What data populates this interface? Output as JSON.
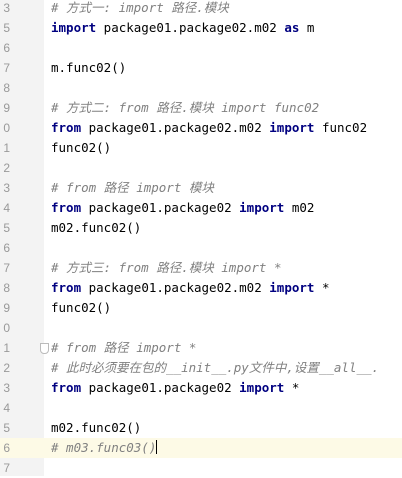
{
  "editor": {
    "lines": [
      {
        "n": "3",
        "parts": [
          {
            "t": "# 方式一: import 路径.模块",
            "c": "cm"
          }
        ]
      },
      {
        "n": "5",
        "parts": [
          {
            "t": "import",
            "c": "kw"
          },
          {
            "t": " package01.package02.m02 ",
            "c": ""
          },
          {
            "t": "as",
            "c": "kw"
          },
          {
            "t": " m",
            "c": ""
          }
        ]
      },
      {
        "n": "6",
        "parts": []
      },
      {
        "n": "7",
        "parts": [
          {
            "t": "m.func02()",
            "c": ""
          }
        ]
      },
      {
        "n": "8",
        "parts": []
      },
      {
        "n": "9",
        "parts": [
          {
            "t": "# 方式二: from 路径.模块 import func02",
            "c": "cm"
          }
        ]
      },
      {
        "n": "0",
        "parts": [
          {
            "t": "from",
            "c": "kw"
          },
          {
            "t": " package01.package02.m02 ",
            "c": ""
          },
          {
            "t": "import",
            "c": "kw"
          },
          {
            "t": " func02",
            "c": ""
          }
        ]
      },
      {
        "n": "1",
        "parts": [
          {
            "t": "func02()",
            "c": ""
          }
        ]
      },
      {
        "n": "2",
        "parts": []
      },
      {
        "n": "3",
        "parts": [
          {
            "t": "# from 路径 import 模块",
            "c": "cm"
          }
        ]
      },
      {
        "n": "4",
        "parts": [
          {
            "t": "from",
            "c": "kw"
          },
          {
            "t": " package01.package02 ",
            "c": ""
          },
          {
            "t": "import",
            "c": "kw"
          },
          {
            "t": " m02",
            "c": ""
          }
        ]
      },
      {
        "n": "5",
        "parts": [
          {
            "t": "m02.func02()",
            "c": ""
          }
        ]
      },
      {
        "n": "6",
        "parts": []
      },
      {
        "n": "7",
        "parts": [
          {
            "t": "# 方式三: from 路径.模块 import *",
            "c": "cm"
          }
        ]
      },
      {
        "n": "8",
        "parts": [
          {
            "t": "from",
            "c": "kw"
          },
          {
            "t": " package01.package02.m02 ",
            "c": ""
          },
          {
            "t": "import",
            "c": "kw"
          },
          {
            "t": " *",
            "c": ""
          }
        ]
      },
      {
        "n": "9",
        "parts": [
          {
            "t": "func02()",
            "c": ""
          }
        ]
      },
      {
        "n": "0",
        "parts": []
      },
      {
        "n": "1",
        "fold": true,
        "parts": [
          {
            "t": "# from 路径 import *",
            "c": "cm"
          }
        ]
      },
      {
        "n": "2",
        "parts": [
          {
            "t": "# 此时必须要在包的__init__.py文件中,设置__all__.",
            "c": "cm"
          }
        ]
      },
      {
        "n": "3",
        "parts": [
          {
            "t": "from",
            "c": "kw"
          },
          {
            "t": " package01.package02 ",
            "c": ""
          },
          {
            "t": "import",
            "c": "kw"
          },
          {
            "t": " *",
            "c": ""
          }
        ]
      },
      {
        "n": "4",
        "parts": []
      },
      {
        "n": "5",
        "parts": [
          {
            "t": "m02.func02()",
            "c": ""
          }
        ]
      },
      {
        "n": "6",
        "current": true,
        "caret": true,
        "parts": [
          {
            "t": "# m03.func03()",
            "c": "cm"
          }
        ]
      },
      {
        "n": "7",
        "parts": []
      }
    ]
  }
}
